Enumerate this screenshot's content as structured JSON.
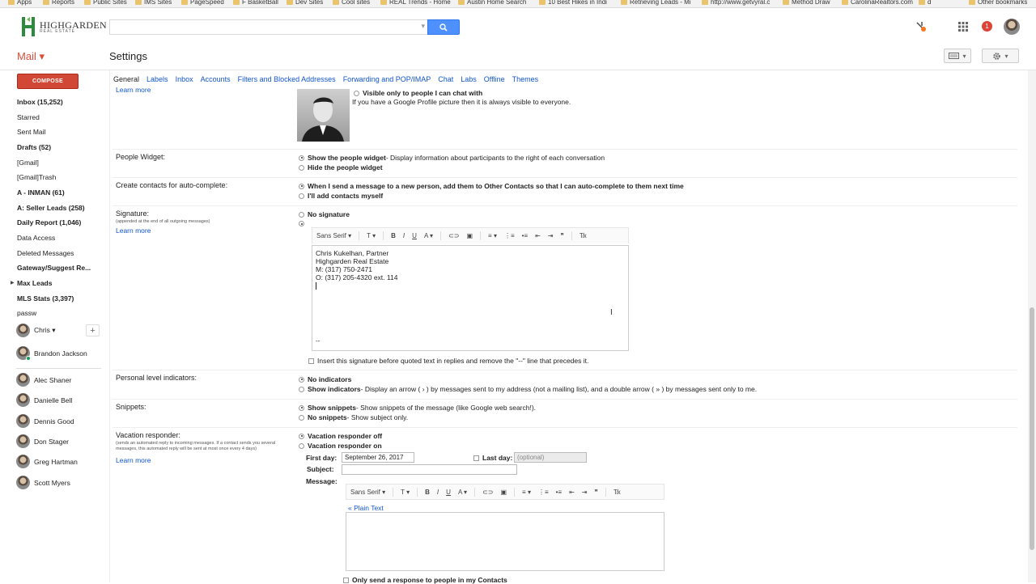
{
  "bookmarks": [
    "Apps",
    "Reports",
    "Public Sites",
    "IMS Sites",
    "PageSpeed",
    "F BasketBall",
    "Dev Sites",
    "Cool sites",
    "REAL Trends - Home",
    "Austin Home Search",
    "10 Best Hikes in Indi",
    "Retrieving Leads - Mi",
    "http://www.getvyral.c",
    "Method Draw",
    "CarolinaRealtors.com",
    "d",
    "Other bookmarks"
  ],
  "logo": {
    "name": "HIGHGARDEN",
    "tag": "REAL ESTATE"
  },
  "header": {
    "notification_count": "1"
  },
  "mail_label": "Mail ▾",
  "page_title": "Settings",
  "compose": "COMPOSE",
  "nav": [
    {
      "label": "Inbox (15,252)",
      "bold": true
    },
    {
      "label": "Starred",
      "bold": false
    },
    {
      "label": "Sent Mail",
      "bold": false
    },
    {
      "label": "Drafts (52)",
      "bold": true
    },
    {
      "label": "[Gmail]",
      "bold": false
    },
    {
      "label": "[Gmail]Trash",
      "bold": false
    },
    {
      "label": "A - INMAN (61)",
      "bold": true
    },
    {
      "label": "A: Seller Leads (258)",
      "bold": true
    },
    {
      "label": "Daily Report (1,046)",
      "bold": true
    },
    {
      "label": "Data Access",
      "bold": false
    },
    {
      "label": "Deleted Messages",
      "bold": false
    },
    {
      "label": "Gateway/Suggest Re...",
      "bold": true
    },
    {
      "label": "Max Leads",
      "bold": true
    },
    {
      "label": "MLS Stats (3,397)",
      "bold": true
    },
    {
      "label": "passw",
      "bold": false
    }
  ],
  "me": "Chris ▾",
  "contacts": [
    "Brandon Jackson",
    "Alec Shaner",
    "Danielle Bell",
    "Dennis Good",
    "Don Stager",
    "Greg Hartman",
    "Scott Myers"
  ],
  "tabs": [
    "General",
    "Labels",
    "Inbox",
    "Accounts",
    "Filters and Blocked Addresses",
    "Forwarding and POP/IMAP",
    "Chat",
    "Labs",
    "Offline",
    "Themes"
  ],
  "picture": {
    "learn_more": "Learn more",
    "visible_option": "Visible only to people I can chat with",
    "note": "If you have a Google Profile picture then it is always visible to everyone."
  },
  "people_widget": {
    "label": "People Widget:",
    "opt1_bold": "Show the people widget",
    "opt1_rest": " - Display information about participants to the right of each conversation",
    "opt2": "Hide the people widget"
  },
  "contacts_auto": {
    "label": "Create contacts for auto-complete:",
    "opt1": "When I send a message to a new person, add them to Other Contacts so that I can auto-complete to them next time",
    "opt2": "I'll add contacts myself"
  },
  "signature": {
    "label": "Signature:",
    "sub": "(appended at the end of all outgoing messages)",
    "learn_more": "Learn more",
    "no_sig": "No signature",
    "font": "Sans Serif",
    "lines": [
      "Chris Kukelhan, Partner",
      "Highgarden Real Estate",
      "M: (317) 750-2471",
      "O: (317) 205-4320 ext. 114"
    ],
    "dash": "--",
    "insert_opt": "Insert this signature before quoted text in replies and remove the \"--\" line that precedes it."
  },
  "indicators": {
    "label": "Personal level indicators:",
    "opt1": "No indicators",
    "opt2_bold": "Show indicators",
    "opt2_rest": " - Display an arrow ( › ) by messages sent to my address (not a mailing list), and a double arrow ( » ) by messages sent only to me."
  },
  "snippets": {
    "label": "Snippets:",
    "opt1_bold": "Show snippets",
    "opt1_rest": " - Show snippets of the message (like Google web search!).",
    "opt2_bold": "No snippets",
    "opt2_rest": " - Show subject only."
  },
  "vacation": {
    "label": "Vacation responder:",
    "sub": "(sends an automated reply to incoming messages. If a contact sends you several messages, this automated reply will be sent at most once every 4 days)",
    "learn_more": "Learn more",
    "off": "Vacation responder off",
    "on": "Vacation responder on",
    "first_day_label": "First day:",
    "first_day": "September 26, 2017",
    "last_day_label": "Last day:",
    "last_day_placeholder": "(optional)",
    "subject_label": "Subject:",
    "message_label": "Message:",
    "font": "Sans Serif",
    "plain_text": "« Plain Text",
    "only_contacts": "Only send a response to people in my Contacts"
  }
}
